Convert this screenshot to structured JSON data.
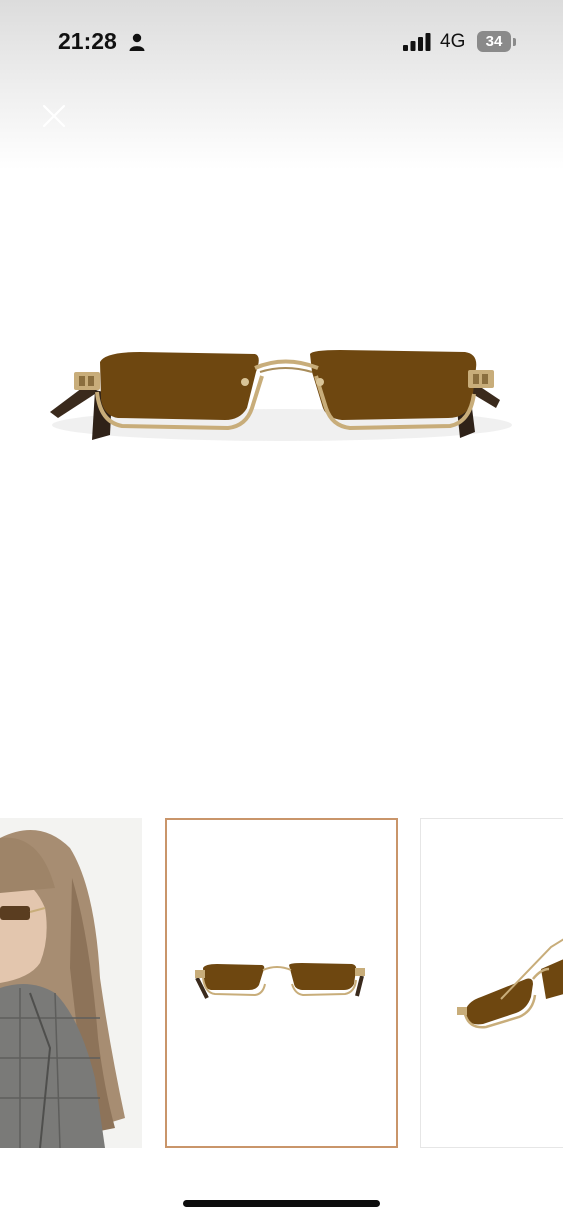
{
  "status_bar": {
    "time": "21:28",
    "network": "4G",
    "battery_level": "34"
  },
  "icons": {
    "person": "person-icon",
    "signal": "signal-icon",
    "close": "close-icon"
  },
  "gallery": {
    "selected_index": 1,
    "thumbnails": [
      {
        "name": "model-wearing-sunglasses"
      },
      {
        "name": "sunglasses-front-view"
      },
      {
        "name": "sunglasses-angle-view"
      }
    ]
  },
  "colors": {
    "lens": "#6e4710",
    "frame": "#c8ad7a",
    "selected_border": "#c9956a"
  }
}
